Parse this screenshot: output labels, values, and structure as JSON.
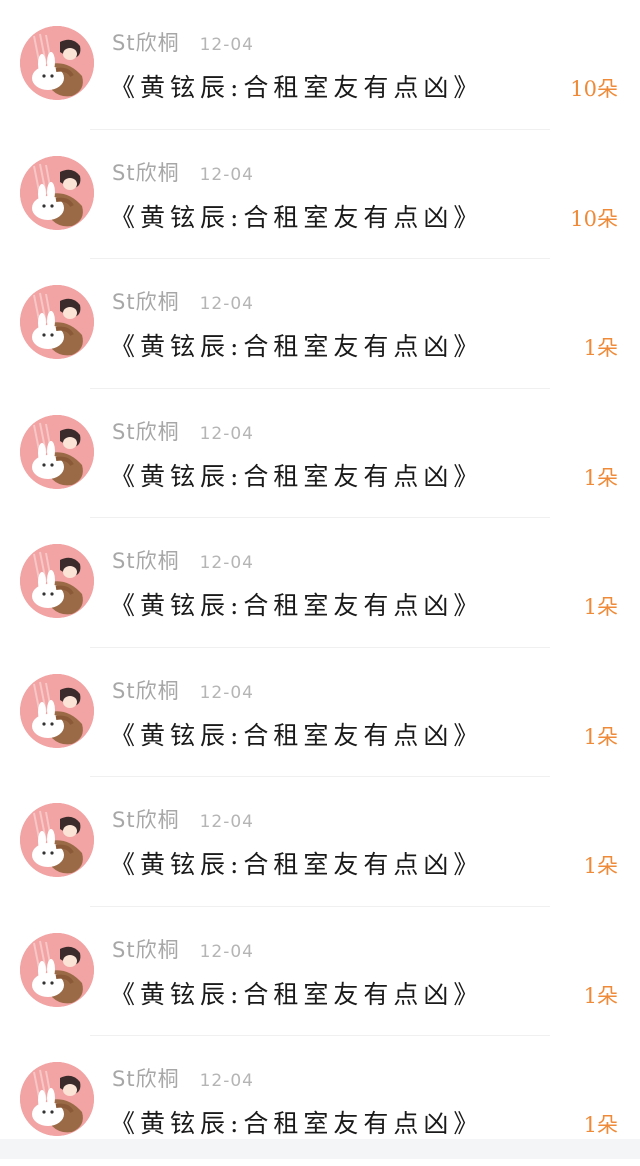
{
  "colors": {
    "background": "#ffffff",
    "username": "#a7a7a7",
    "date": "#b5b5b5",
    "title": "#1a1a1a",
    "gift": "#ef8a38",
    "avatar_bg": "#f09a9a"
  },
  "avatar_icon": "cartoon-couple-avatar",
  "items": [
    {
      "username": "St欣桐",
      "date": "12-04",
      "title": "《黄铉辰:合租室友有点凶》",
      "gift": "10朵"
    },
    {
      "username": "St欣桐",
      "date": "12-04",
      "title": "《黄铉辰:合租室友有点凶》",
      "gift": "10朵"
    },
    {
      "username": "St欣桐",
      "date": "12-04",
      "title": "《黄铉辰:合租室友有点凶》",
      "gift": "1朵"
    },
    {
      "username": "St欣桐",
      "date": "12-04",
      "title": "《黄铉辰:合租室友有点凶》",
      "gift": "1朵"
    },
    {
      "username": "St欣桐",
      "date": "12-04",
      "title": "《黄铉辰:合租室友有点凶》",
      "gift": "1朵"
    },
    {
      "username": "St欣桐",
      "date": "12-04",
      "title": "《黄铉辰:合租室友有点凶》",
      "gift": "1朵"
    },
    {
      "username": "St欣桐",
      "date": "12-04",
      "title": "《黄铉辰:合租室友有点凶》",
      "gift": "1朵"
    },
    {
      "username": "St欣桐",
      "date": "12-04",
      "title": "《黄铉辰:合租室友有点凶》",
      "gift": "1朵"
    },
    {
      "username": "St欣桐",
      "date": "12-04",
      "title": "《黄铉辰:合租室友有点凶》",
      "gift": "1朵"
    }
  ]
}
